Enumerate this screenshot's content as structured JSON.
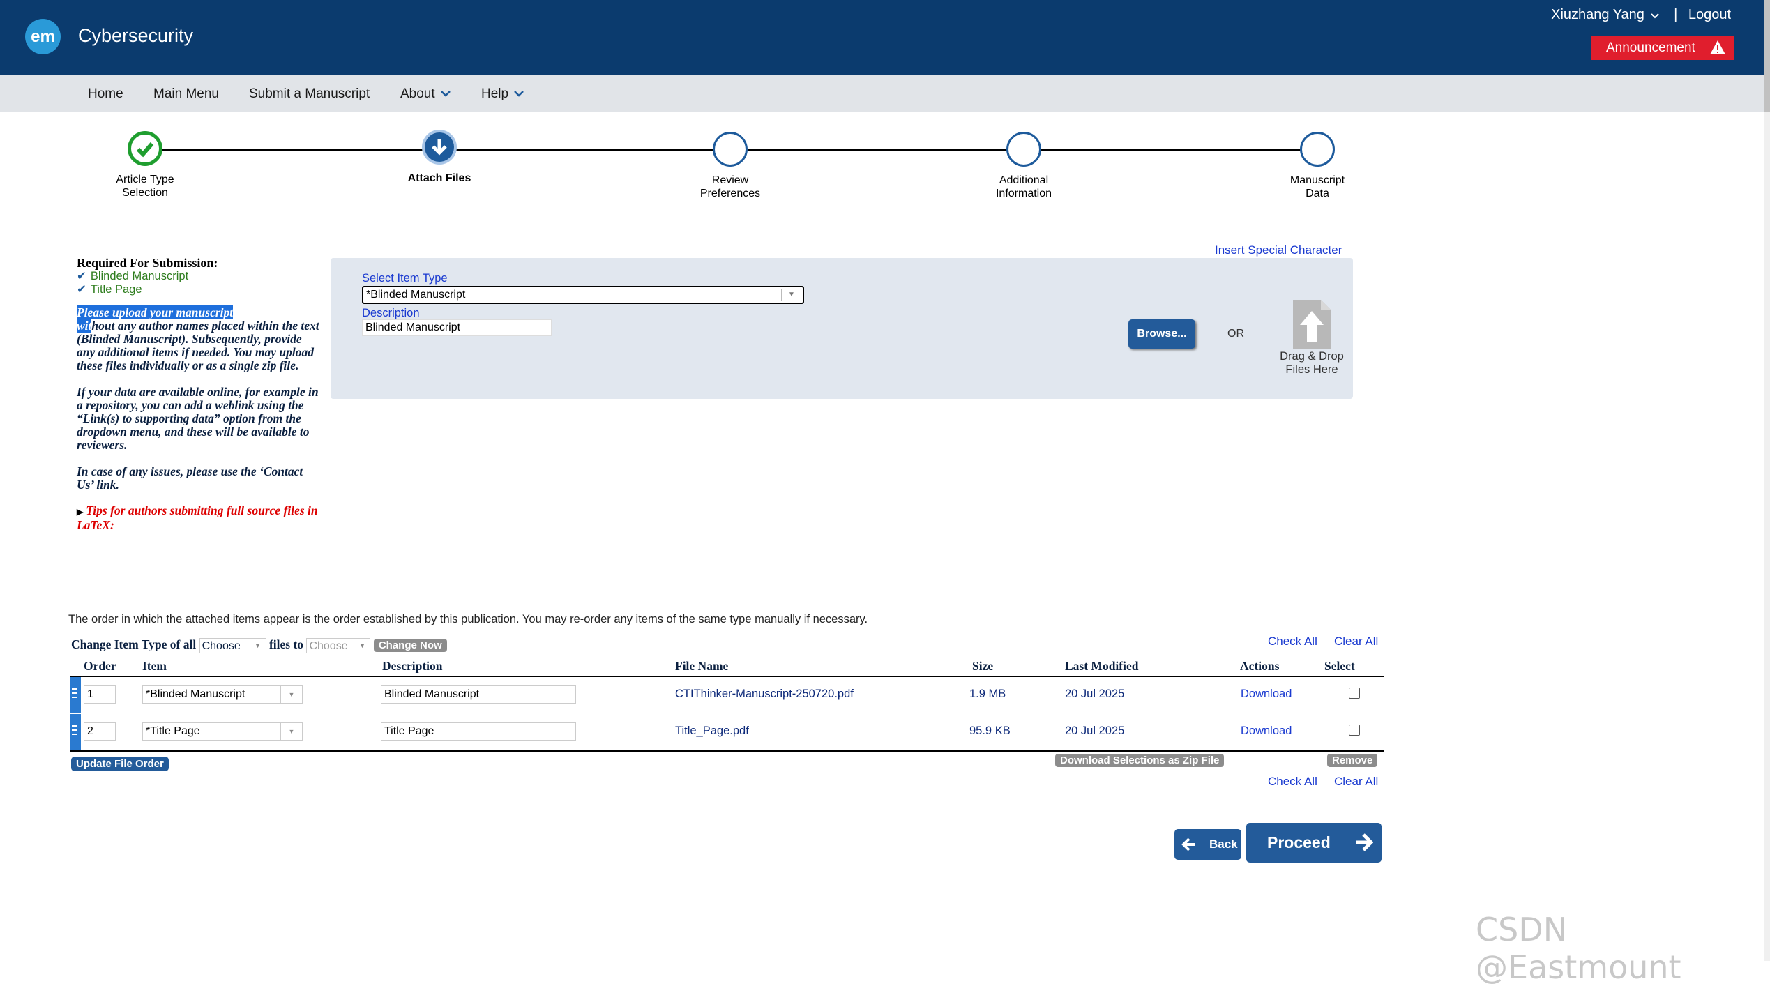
{
  "header": {
    "logo_text": "em",
    "journal_name": "Cybersecurity",
    "username": "Xiuzhang Yang",
    "separator": "|",
    "logout": "Logout",
    "announcement": "Announcement"
  },
  "nav": {
    "items": [
      "Home",
      "Main Menu",
      "Submit a Manuscript",
      "About",
      "Help"
    ]
  },
  "steps": [
    {
      "line1": "Article Type",
      "line2": "Selection",
      "state": "completed"
    },
    {
      "line1": "Attach Files",
      "line2": "",
      "state": "current"
    },
    {
      "line1": "Review",
      "line2": "Preferences",
      "state": "pending"
    },
    {
      "line1": "Additional",
      "line2": "Information",
      "state": "pending"
    },
    {
      "line1": "Manuscript",
      "line2": "Data",
      "state": "pending"
    }
  ],
  "left_panel": {
    "required_title": "Required For Submission:",
    "required_items": [
      "Blinded Manuscript",
      "Title Page"
    ],
    "instr1_highlight_a": "Please upload your manuscript ",
    "instr1_highlight_b": "wit",
    "instr1_rest": "hout any author names placed within the text (Blinded Manuscript). Subsequently, provide any additional items if needed. You may upload these files individually or as a single zip file.",
    "instr2": "If your data are available online, for example in a repository, you can add a weblink using the “Link(s) to supporting data” option from the dropdown menu, and these will be available to reviewers.",
    "instr3": "In case of any issues, please use the ‘Contact Us’ link.",
    "latex_tip": "Tips for authors submitting full source files in LaTeX:"
  },
  "upload": {
    "special_char_link": "Insert Special Character",
    "select_label": "Select Item Type",
    "selected_item_type": "*Blinded Manuscript",
    "description_label": "Description",
    "description_value": "Blinded Manuscript",
    "browse_button": "Browse...",
    "or_text": "OR",
    "drop_line1": "Drag & Drop",
    "drop_line2": "Files Here"
  },
  "files": {
    "order_note": "The order in which the attached items appear is the order established by this publication. You may re-order any items of the same type manually if necessary.",
    "change_label_a": "Change Item Type of all",
    "change_label_b": "files to",
    "choose": "Choose",
    "change_now": "Change Now",
    "check_all": "Check All",
    "clear_all": "Clear All",
    "columns": [
      "Order",
      "Item",
      "Description",
      "File Name",
      "Size",
      "Last Modified",
      "Actions",
      "Select"
    ],
    "rows": [
      {
        "order": "1",
        "item": "*Blinded Manuscript",
        "description": "Blinded Manuscript",
        "file_name": "CTIThinker-Manuscript-250720.pdf",
        "size": "1.9 MB",
        "last_modified": "20 Jul 2025",
        "action": "Download"
      },
      {
        "order": "2",
        "item": "*Title Page",
        "description": "Title Page",
        "file_name": "Title_Page.pdf",
        "size": "95.9 KB",
        "last_modified": "20 Jul 2025",
        "action": "Download"
      }
    ],
    "update_order": "Update File Order",
    "download_zip": "Download Selections as Zip File",
    "remove": "Remove"
  },
  "footer": {
    "back": "Back",
    "proceed": "Proceed"
  },
  "watermark": "CSDN @Eastmount",
  "colors": {
    "header_bg": "#0b3b6e",
    "nav_bg": "#e1e4e8",
    "accent": "#235b9a",
    "success": "#1f9e2f",
    "announcement": "#e01e2d"
  }
}
